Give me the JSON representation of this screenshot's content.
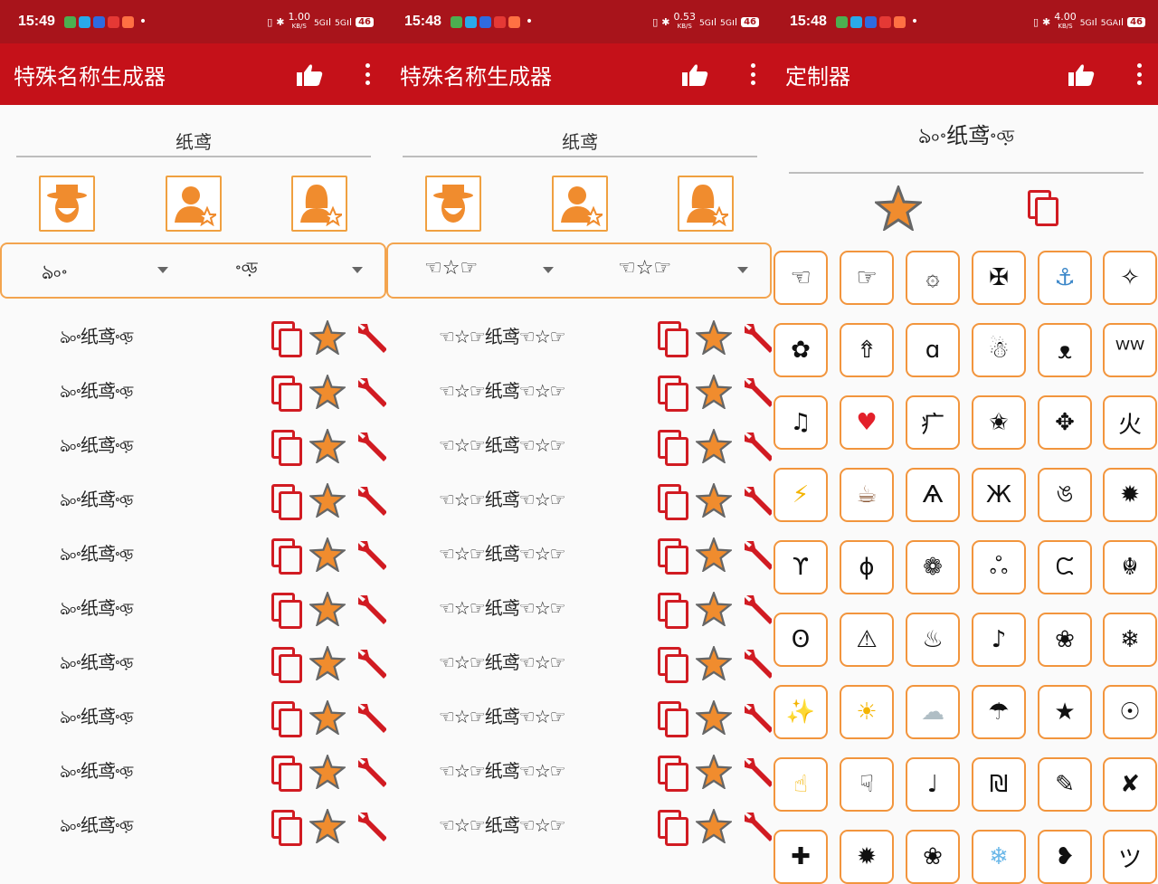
{
  "screens": [
    {
      "status": {
        "time": "15:49",
        "speed": "1.00",
        "speed_unit": "KB/S",
        "net": "5G",
        "net2": "5G",
        "battery": "46"
      },
      "appbar": {
        "title": "特殊名称生成器"
      },
      "input": {
        "value": "纸鸢"
      },
      "dropdowns": [
        "ঌ৹৽",
        "৽৹ড়"
      ],
      "rows": [
        "ঌ৹৽纸鸢৽৹ড়",
        "ঌ৹৽纸鸢৽৹ড়",
        "ঌ৹৽纸鸢৽৹ড়",
        "ঌ৹৽纸鸢৽৹ড়",
        "ঌ৹৽纸鸢৽৹ড়",
        "ঌ৹৽纸鸢৽৹ড়",
        "ঌ৹৽纸鸢৽৹ড়",
        "ঌ৹৽纸鸢৽৹ড়",
        "ঌ৹৽纸鸢৽৹ড়",
        "ঌ৹৽纸鸢৽৹ড়"
      ]
    },
    {
      "status": {
        "time": "15:48",
        "speed": "0.53",
        "speed_unit": "KB/S",
        "net": "5G",
        "net2": "5G",
        "battery": "46"
      },
      "appbar": {
        "title": "特殊名称生成器"
      },
      "input": {
        "value": "纸鸢"
      },
      "dropdowns": [
        "☜☆☞",
        "☜☆☞"
      ],
      "rows": [
        "☜☆☞纸鸢☜☆☞",
        "☜☆☞纸鸢☜☆☞",
        "☜☆☞纸鸢☜☆☞",
        "☜☆☞纸鸢☜☆☞",
        "☜☆☞纸鸢☜☆☞",
        "☜☆☞纸鸢☜☆☞",
        "☜☆☞纸鸢☜☆☞",
        "☜☆☞纸鸢☜☆☞",
        "☜☆☞纸鸢☜☆☞",
        "☜☆☞纸鸢☜☆☞"
      ]
    },
    {
      "status": {
        "time": "15:48",
        "speed": "4.00",
        "speed_unit": "KB/S",
        "net": "5G",
        "net2": "5GA",
        "battery": "46"
      },
      "appbar": {
        "title": "定制器"
      },
      "preview": "ঌ৹৽纸鸢৽৹ড়",
      "symbols": [
        {
          "glyph": "☜",
          "color": "#111"
        },
        {
          "glyph": "☞",
          "color": "#111"
        },
        {
          "glyph": "۞",
          "color": "#111"
        },
        {
          "glyph": "✠",
          "color": "#111"
        },
        {
          "glyph": "⚓",
          "color": "#3a86c8"
        },
        {
          "glyph": "✧",
          "color": "#111"
        },
        {
          "glyph": "✿",
          "color": "#111"
        },
        {
          "glyph": "⇮",
          "color": "#111"
        },
        {
          "glyph": "ɑ",
          "color": "#111"
        },
        {
          "glyph": "☃",
          "color": "#111"
        },
        {
          "glyph": "ᴥ",
          "color": "#111"
        },
        {
          "glyph": "ᵂᵂ",
          "color": "#111"
        },
        {
          "glyph": "♫",
          "color": "#111"
        },
        {
          "glyph": "♥",
          "color": "#e3202a"
        },
        {
          "glyph": "⽧",
          "color": "#111"
        },
        {
          "glyph": "✬",
          "color": "#111"
        },
        {
          "glyph": "✥",
          "color": "#111"
        },
        {
          "glyph": "⽕",
          "color": "#111"
        },
        {
          "glyph": "⚡",
          "color": "#f4b400"
        },
        {
          "glyph": "☕",
          "color": "#8d5b3a"
        },
        {
          "glyph": "Ѧ",
          "color": "#111"
        },
        {
          "glyph": "Ж",
          "color": "#111"
        },
        {
          "glyph": "ঙ",
          "color": "#111"
        },
        {
          "glyph": "✹",
          "color": "#111"
        },
        {
          "glyph": "ϒ",
          "color": "#111"
        },
        {
          "glyph": "ɸ",
          "color": "#111"
        },
        {
          "glyph": "❁",
          "color": "#111"
        },
        {
          "glyph": "ஃ",
          "color": "#111"
        },
        {
          "glyph": "ᙅ",
          "color": "#111"
        },
        {
          "glyph": "☬",
          "color": "#111"
        },
        {
          "glyph": "ʘ",
          "color": "#111"
        },
        {
          "glyph": "⚠",
          "color": "#111"
        },
        {
          "glyph": "♨",
          "color": "#111"
        },
        {
          "glyph": "♪",
          "color": "#111"
        },
        {
          "glyph": "❀",
          "color": "#111"
        },
        {
          "glyph": "❄",
          "color": "#111"
        },
        {
          "glyph": "✨",
          "color": "#f4b400"
        },
        {
          "glyph": "☀",
          "color": "#f4b400"
        },
        {
          "glyph": "☁",
          "color": "#b0bec5"
        },
        {
          "glyph": "☂",
          "color": "#111"
        },
        {
          "glyph": "★",
          "color": "#111"
        },
        {
          "glyph": "☉",
          "color": "#111"
        },
        {
          "glyph": "☝",
          "color": "#f4b400"
        },
        {
          "glyph": "☟",
          "color": "#111"
        },
        {
          "glyph": "♩",
          "color": "#111"
        },
        {
          "glyph": "₪",
          "color": "#111"
        },
        {
          "glyph": "✎",
          "color": "#111"
        },
        {
          "glyph": "✘",
          "color": "#111"
        },
        {
          "glyph": "✚",
          "color": "#111"
        },
        {
          "glyph": "✹",
          "color": "#111"
        },
        {
          "glyph": "❀",
          "color": "#111"
        },
        {
          "glyph": "❄",
          "color": "#6ab7e8"
        },
        {
          "glyph": "❥",
          "color": "#111"
        },
        {
          "glyph": "ツ",
          "color": "#111"
        }
      ]
    }
  ],
  "colors": {
    "statusbar": "#a8141b",
    "appbar": "#c51119",
    "accent_orange": "#f2953d",
    "icon_red": "#d11b22",
    "star_orange": "#f08c2e"
  }
}
